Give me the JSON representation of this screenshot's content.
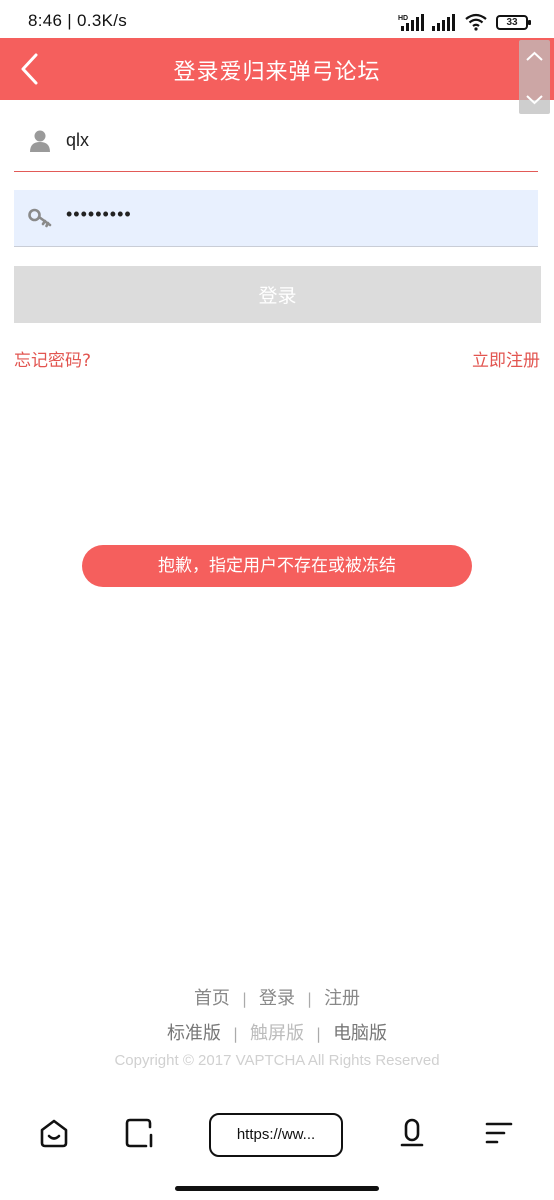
{
  "status_bar": {
    "time_speed": "8:46 | 0.3K/s",
    "network_badge": "HD",
    "battery": "33"
  },
  "header": {
    "title": "登录爱归来弹弓论坛",
    "background_color": "#f55f5d"
  },
  "form": {
    "username": "qlx",
    "password_masked": "•••••••••",
    "login_label": "登录",
    "forgot_label": "忘记密码?",
    "register_label": "立即注册"
  },
  "toast": {
    "message": "抱歉，指定用户不存在或被冻结"
  },
  "footer": {
    "nav": [
      "首页",
      "登录",
      "注册"
    ],
    "versions": [
      "标准版",
      "触屏版",
      "电脑版"
    ],
    "copyright": "Copyright © 2017 VAPTCHA All Rights Reserved"
  },
  "browser": {
    "url": "https://ww..."
  },
  "icons": {
    "back": "chevron-left-icon",
    "user": "user-icon",
    "key": "key-icon",
    "home": "home-icon",
    "tabs": "tabs-icon",
    "mic": "microphone-icon",
    "menu": "menu-icon"
  },
  "colors": {
    "accent": "#f55f5d",
    "link": "#e25550",
    "autofill": "#e8f0fe",
    "button_disabled": "#dcdcdc"
  }
}
